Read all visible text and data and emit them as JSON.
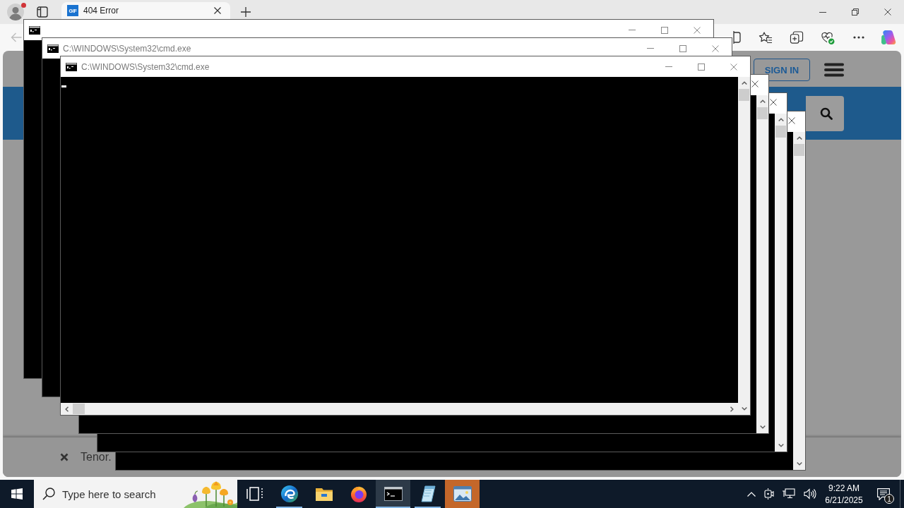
{
  "browser": {
    "profile": {
      "badge": true
    },
    "tabs": [
      {
        "title": "404 Error",
        "favicon_text": "GIF",
        "selected": true
      }
    ],
    "toolbar": {
      "back": {
        "disabled": true
      }
    },
    "page": {
      "sign_in_button": "SIGN IN",
      "notice": {
        "text": "Tenor."
      }
    }
  },
  "cmd_windows": [
    {
      "kind": "bare",
      "active": false
    },
    {
      "kind": "bare",
      "title": "C:\\WINDOWS\\System32\\cmd.exe",
      "active": false
    },
    {
      "kind": "scrolling",
      "title": "C:\\WINDOWS\\System32\\cmd.exe",
      "active": true
    },
    {
      "kind": "stacked",
      "active": false
    },
    {
      "kind": "stacked",
      "active": false
    },
    {
      "kind": "stacked",
      "active": false
    }
  ],
  "taskbar": {
    "search": {
      "placeholder": "Type here to search"
    },
    "apps": [
      {
        "kind": "task-view",
        "running": false,
        "selected": false,
        "flashing": false
      },
      {
        "kind": "browser",
        "running": true,
        "selected": false,
        "flashing": false
      },
      {
        "kind": "folder",
        "running": false,
        "selected": false,
        "flashing": false
      },
      {
        "kind": "fox",
        "running": false,
        "selected": false,
        "flashing": false
      },
      {
        "kind": "console",
        "running": true,
        "selected": true,
        "flashing": false
      },
      {
        "kind": "notepad",
        "running": true,
        "selected": false,
        "flashing": false
      },
      {
        "kind": "picture",
        "running": false,
        "selected": false,
        "flashing": true
      }
    ],
    "clock": {
      "time": "9:22 AM",
      "date": "6/21/2025"
    },
    "notifications": {
      "count": "1"
    }
  }
}
